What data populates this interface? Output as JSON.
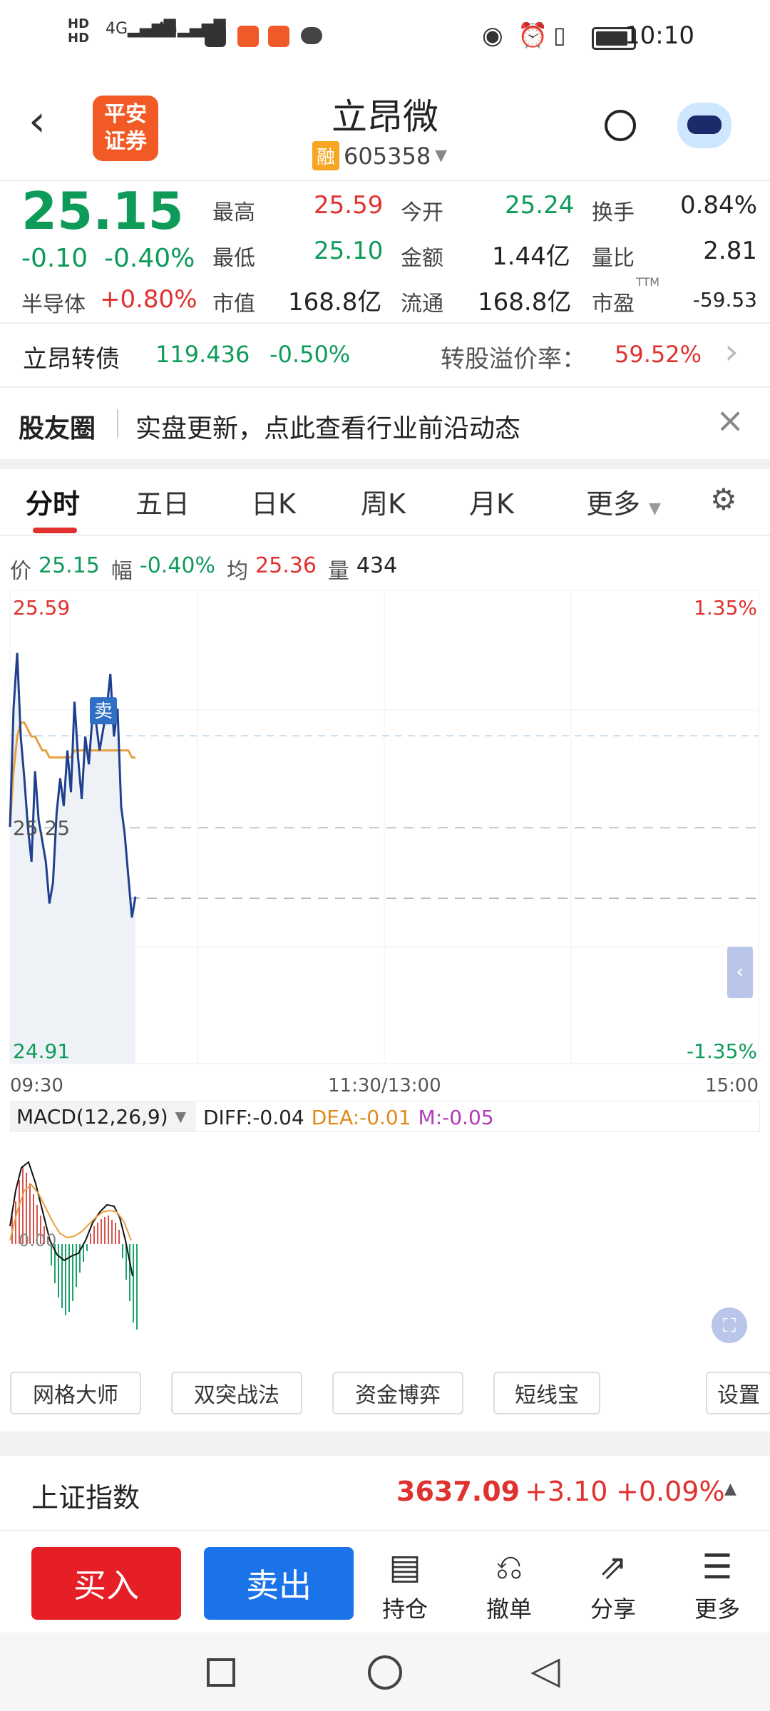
{
  "status_bar": {
    "time": "10:10",
    "signal1": "4G",
    "signal2": "4G"
  },
  "header": {
    "title": "立昂微",
    "code": "605358",
    "rong_tag": "融",
    "logo_line1": "平安",
    "logo_line2": "证券"
  },
  "quote": {
    "price": "25.15",
    "change": "-0.10",
    "change_pct": "-0.40%",
    "sector_name": "半导体",
    "sector_pct": "+0.80%",
    "high_label": "最高",
    "high": "25.59",
    "low_label": "最低",
    "low": "25.10",
    "mcap_label": "市值",
    "mcap": "168.8亿",
    "open_label": "今开",
    "open": "25.24",
    "amount_label": "金额",
    "amount": "1.44亿",
    "float_label": "流通",
    "float": "168.8亿",
    "turnover_label": "换手",
    "turnover": "0.84%",
    "volratio_label": "量比",
    "volratio": "2.81",
    "pe_label": "市盈",
    "pe_sup": "TTM",
    "pe": "-59.53"
  },
  "bond": {
    "name": "立昂转债",
    "price": "119.436",
    "pct": "-0.50%",
    "premium_label": "转股溢价率：",
    "premium": "59.52%"
  },
  "community": {
    "title": "股友圈",
    "text": "实盘更新，点此查看行业前沿动态"
  },
  "tabs": [
    "分时",
    "五日",
    "日K",
    "周K",
    "月K",
    "更多"
  ],
  "chart_info": {
    "price_label": "价",
    "price": "25.15",
    "amp_label": "幅",
    "amp": "-0.40%",
    "avg_label": "均",
    "avg": "25.36",
    "vol_label": "量",
    "vol": "434"
  },
  "chart_labels": {
    "top_price": "25.59",
    "bottom_price": "24.91",
    "top_pct": "1.35%",
    "bottom_pct": "-1.35%",
    "mid_price": "25.25",
    "sell_marker": "卖",
    "t_start": "09:30",
    "t_mid": "11:30/13:00",
    "t_end": "15:00"
  },
  "macd": {
    "title": "MACD(12,26,9)",
    "diff": "DIFF:-0.04",
    "dea": "DEA:-0.01",
    "m": "M:-0.05",
    "zero": "0.00"
  },
  "tools": [
    "网格大师",
    "双突战法",
    "资金博弈",
    "短线宝",
    "设置"
  ],
  "index_bar": {
    "name": "上证指数",
    "value": "3637.09",
    "change": "+3.10",
    "pct": "+0.09%"
  },
  "bottom": {
    "buy": "买入",
    "sell": "卖出",
    "hold": "持仓",
    "cancel": "撤单",
    "share": "分享",
    "more": "更多"
  },
  "chart_data": {
    "type": "line",
    "x_range": [
      "09:30",
      "15:00"
    ],
    "ylim": [
      24.91,
      25.59
    ],
    "series": [
      {
        "values": [
          25.25,
          25.42,
          25.5,
          25.38,
          25.32,
          25.25,
          25.2,
          25.33,
          25.26,
          25.23,
          25.2,
          25.14,
          25.17,
          25.27,
          25.32,
          25.28,
          25.36,
          25.3,
          25.43,
          25.35,
          25.29,
          25.38,
          25.34,
          25.41,
          25.4,
          25.36,
          25.39,
          25.42,
          25.47,
          25.38,
          25.42,
          25.28,
          25.24,
          25.18,
          25.12,
          25.15
        ]
      },
      {
        "values": [
          25.25,
          25.33,
          25.38,
          25.4,
          25.4,
          25.39,
          25.38,
          25.38,
          25.37,
          25.36,
          25.36,
          25.35,
          25.35,
          25.35,
          25.35,
          25.35,
          25.35,
          25.35,
          25.36,
          25.36,
          25.36,
          25.36,
          25.36,
          25.36,
          25.36,
          25.36,
          25.36,
          25.36,
          25.36,
          25.36,
          25.36,
          25.36,
          25.36,
          25.36,
          25.35,
          25.35
        ]
      }
    ],
    "reference_lines": [
      25.25
    ],
    "colors": {
      "price": "#1f3f8f",
      "avg": "#e8a040"
    }
  }
}
